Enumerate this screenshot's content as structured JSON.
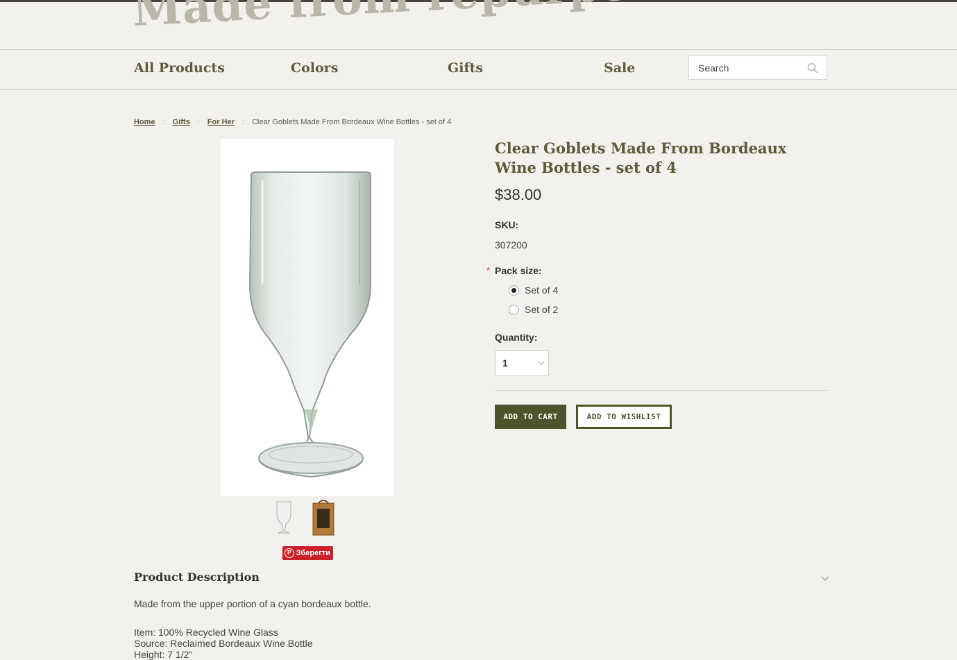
{
  "banner": {
    "text": "Made from repurposed bottles"
  },
  "nav": {
    "items": [
      "All Products",
      "Colors",
      "Gifts",
      "Sale"
    ]
  },
  "search": {
    "placeholder": "Search",
    "icon": "search-icon"
  },
  "breadcrumb": {
    "home": "Home",
    "gifts": "Gifts",
    "for_her": "For Her",
    "current": "Clear Goblets Made From Bordeaux Wine Bottles - set of 4"
  },
  "product": {
    "title": "Clear Goblets Made From Bordeaux Wine Bottles - set of 4",
    "price": "$38.00",
    "sku_label": "SKU:",
    "sku_value": "307200",
    "pack_label": "Pack size:",
    "required_mark": "*",
    "pack_options": [
      "Set of 4",
      "Set of 2"
    ],
    "pack_selected": "Set of 4",
    "quantity_label": "Quantity:",
    "quantity_value": "1",
    "add_to_cart": "ADD TO CART",
    "add_to_wishlist": "ADD TO WISHLIST"
  },
  "pinterest": {
    "label": "Зберегти",
    "glyph": "P"
  },
  "description": {
    "title": "Product Description",
    "intro": "Made from the upper portion of a cyan bordeaux bottle.",
    "lines": [
      "Item: 100% Recycled Wine Glass",
      "Source: Reclaimed Bordeaux Wine Bottle",
      "Height: 7 1/2\""
    ]
  },
  "colors": {
    "accent": "#4e5429",
    "nav_text": "#5f5a3a",
    "pin": "#cb2027"
  }
}
